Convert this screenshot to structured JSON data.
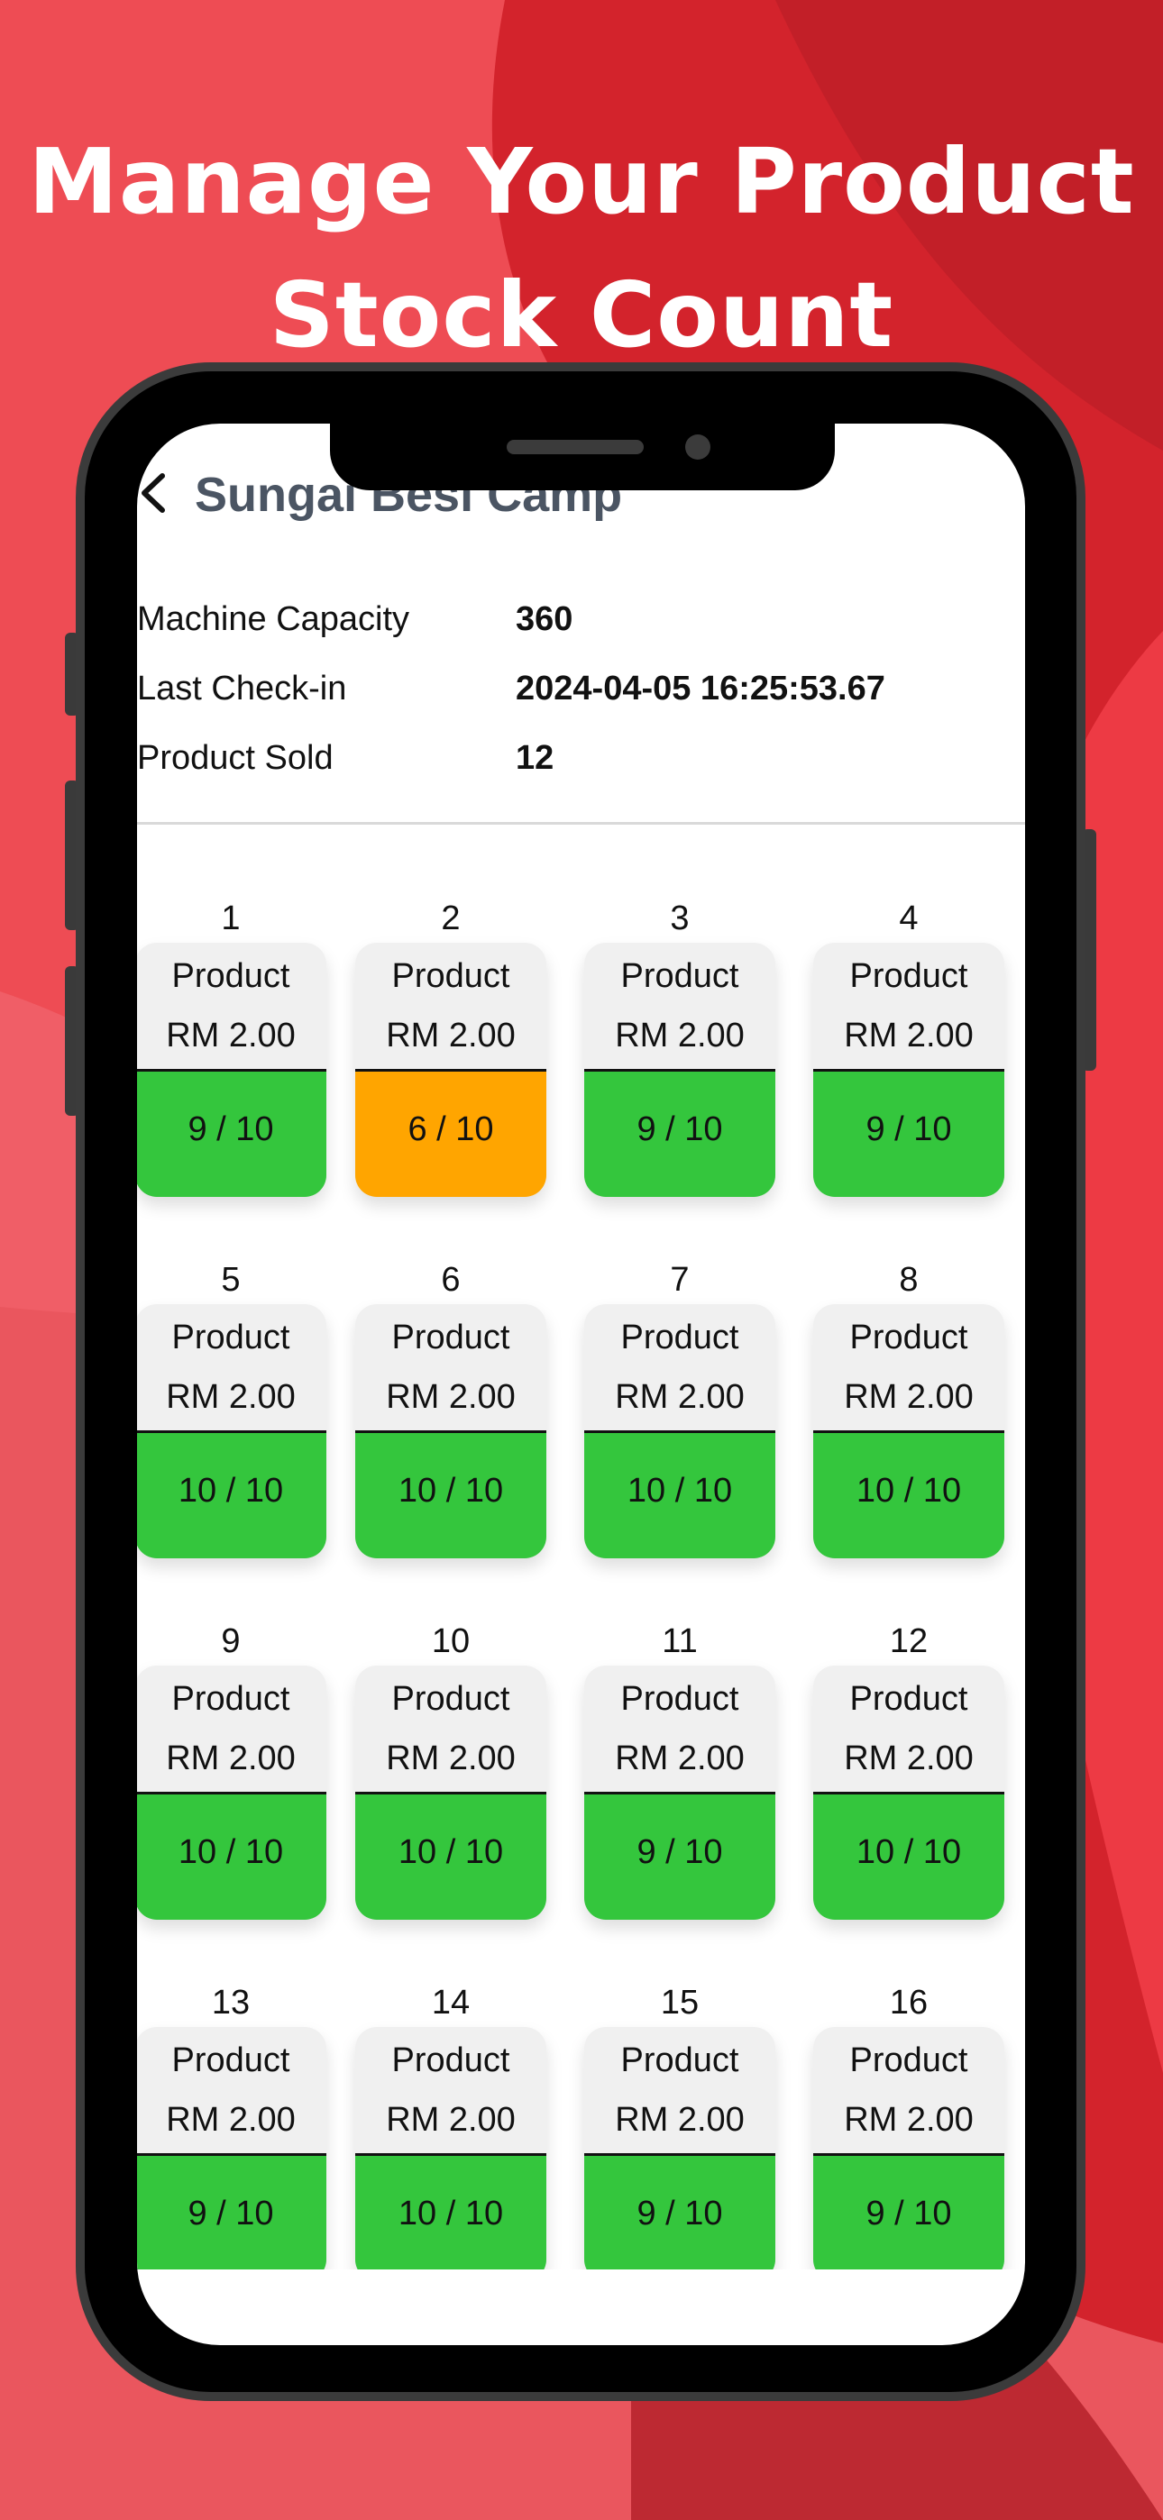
{
  "headline": {
    "line1": "Manage Your Product",
    "line2": "Stock Count"
  },
  "header": {
    "back_icon": "chevron-left-icon",
    "title": "Sungai Besi Camp"
  },
  "info": [
    {
      "label": "Machine Capacity",
      "value": "360"
    },
    {
      "label": "Last Check-in",
      "value": "2024-04-05 16:25:53.67"
    },
    {
      "label": "Product Sold",
      "value": "12"
    }
  ],
  "colors": {
    "stock_full": "#34c63d",
    "stock_low": "#ffa500",
    "title_text": "#4b5563"
  },
  "slots": [
    {
      "number": "1",
      "name": "Product",
      "price": "RM 2.00",
      "stock": "9 / 10",
      "status": "ok"
    },
    {
      "number": "2",
      "name": "Product",
      "price": "RM 2.00",
      "stock": "6 / 10",
      "status": "low"
    },
    {
      "number": "3",
      "name": "Product",
      "price": "RM 2.00",
      "stock": "9 / 10",
      "status": "ok"
    },
    {
      "number": "4",
      "name": "Product",
      "price": "RM 2.00",
      "stock": "9 / 10",
      "status": "ok"
    },
    {
      "number": "5",
      "name": "Product",
      "price": "RM 2.00",
      "stock": "10 / 10",
      "status": "ok"
    },
    {
      "number": "6",
      "name": "Product",
      "price": "RM 2.00",
      "stock": "10 / 10",
      "status": "ok"
    },
    {
      "number": "7",
      "name": "Product",
      "price": "RM 2.00",
      "stock": "10 / 10",
      "status": "ok"
    },
    {
      "number": "8",
      "name": "Product",
      "price": "RM 2.00",
      "stock": "10 / 10",
      "status": "ok"
    },
    {
      "number": "9",
      "name": "Product",
      "price": "RM 2.00",
      "stock": "10 / 10",
      "status": "ok"
    },
    {
      "number": "10",
      "name": "Product",
      "price": "RM 2.00",
      "stock": "10 / 10",
      "status": "ok"
    },
    {
      "number": "11",
      "name": "Product",
      "price": "RM 2.00",
      "stock": "9 / 10",
      "status": "ok"
    },
    {
      "number": "12",
      "name": "Product",
      "price": "RM 2.00",
      "stock": "10 / 10",
      "status": "ok"
    },
    {
      "number": "13",
      "name": "Product",
      "price": "RM 2.00",
      "stock": "9 / 10",
      "status": "ok"
    },
    {
      "number": "14",
      "name": "Product",
      "price": "RM 2.00",
      "stock": "10 / 10",
      "status": "ok"
    },
    {
      "number": "15",
      "name": "Product",
      "price": "RM 2.00",
      "stock": "9 / 10",
      "status": "ok"
    },
    {
      "number": "16",
      "name": "Product",
      "price": "RM 2.00",
      "stock": "9 / 10",
      "status": "ok"
    }
  ]
}
